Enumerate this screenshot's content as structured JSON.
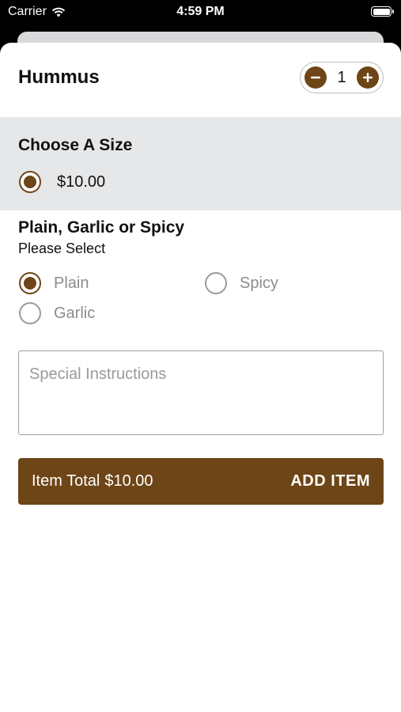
{
  "status_bar": {
    "carrier": "Carrier",
    "time": "4:59 PM"
  },
  "item": {
    "title": "Hummus",
    "quantity": "1"
  },
  "size": {
    "title": "Choose A Size",
    "options": [
      {
        "label": "$10.00",
        "selected": true
      }
    ]
  },
  "flavor": {
    "title": "Plain, Garlic or Spicy",
    "subtitle": "Please Select",
    "options": [
      {
        "label": "Plain",
        "selected": true
      },
      {
        "label": "Spicy",
        "selected": false
      },
      {
        "label": "Garlic",
        "selected": false
      }
    ]
  },
  "instructions": {
    "placeholder": "Special Instructions"
  },
  "footer": {
    "total_label": "Item Total",
    "total_value": "$10.00",
    "add_label": "ADD ITEM"
  },
  "colors": {
    "accent": "#6e4517",
    "section_bg": "#e6e7e8"
  }
}
